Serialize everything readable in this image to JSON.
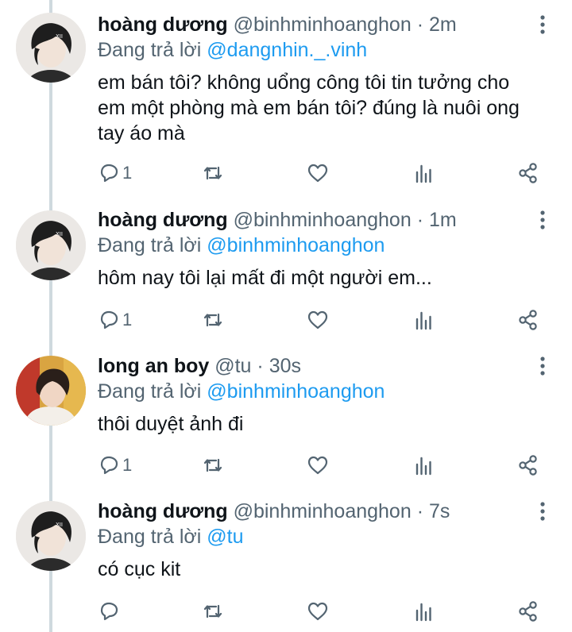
{
  "tweets": [
    {
      "name": "hoàng dương",
      "handle": "@binhminhoanghon",
      "separator": "·",
      "time": "2m",
      "reply_prefix": "Đang trả lời",
      "reply_mention": "@dangnhin._.vinh",
      "text_lines": [
        "em bán tôi? không uổng công tôi tin tưởng cho",
        "em một phòng mà em bán tôi? đúng là nuôi ong",
        "tay áo mà"
      ],
      "reply_count": "1",
      "avatar_icon": "avatar-boy-icon"
    },
    {
      "name": "hoàng dương",
      "handle": "@binhminhoanghon",
      "separator": "·",
      "time": "1m",
      "reply_prefix": "Đang trả lời",
      "reply_mention": "@binhminhoanghon",
      "text_lines": [
        "hôm nay tôi lại mất đi một người em..."
      ],
      "reply_count": "1",
      "avatar_icon": "avatar-boy-icon"
    },
    {
      "name": "long an boy",
      "handle": "@tu",
      "separator": "·",
      "time": "30s",
      "reply_prefix": "Đang trả lời",
      "reply_mention": "@binhminhoanghon",
      "text_lines": [
        "thôi duyệt ảnh đi"
      ],
      "reply_count": "1",
      "avatar_icon": "avatar-colorful-icon"
    },
    {
      "name": "hoàng dương",
      "handle": "@binhminhoanghon",
      "separator": "·",
      "time": "7s",
      "reply_prefix": "Đang trả lời",
      "reply_mention": "@tu",
      "text_lines": [
        "có cục kit"
      ],
      "reply_count": "",
      "avatar_icon": "avatar-boy-icon"
    }
  ],
  "colors": {
    "text": "#0f1419",
    "secondary": "#536471",
    "link": "#1d9bf0",
    "thread_line": "#cfd9de"
  }
}
